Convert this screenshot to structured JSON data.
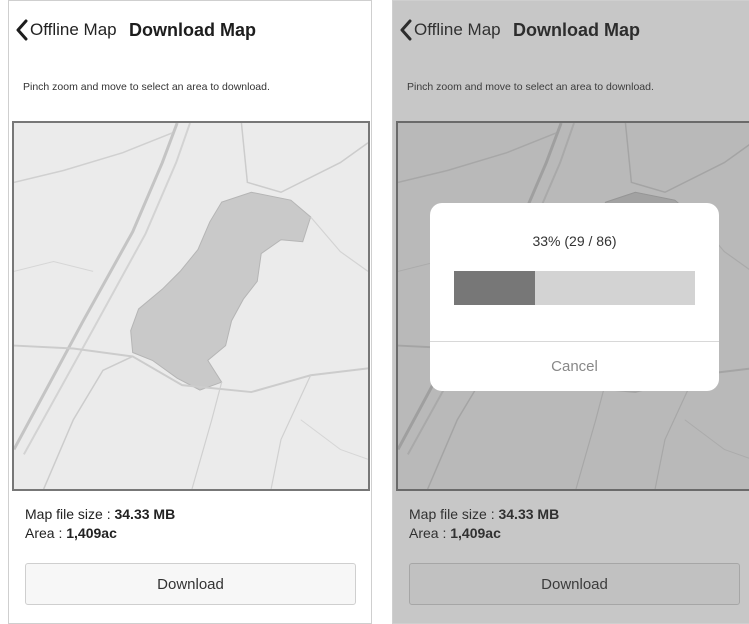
{
  "left": {
    "nav": {
      "back_label": "Offline Map",
      "title": "Download Map"
    },
    "instructions": "Pinch zoom and move to select an area to download.",
    "info": {
      "size_label": "Map file size : ",
      "size_value": "34.33 MB",
      "area_label": "Area : ",
      "area_value": "1,409ac"
    },
    "download_label": "Download"
  },
  "right": {
    "nav": {
      "back_label": "Offline Map",
      "title": "Download Map"
    },
    "instructions": "Pinch zoom and move to select an area to download.",
    "info": {
      "size_label": "Map file size : ",
      "size_value": "34.33 MB",
      "area_label": "Area : ",
      "area_value": "1,409ac"
    },
    "download_label": "Download",
    "dialog": {
      "progress_text": "33% (29 / 86)",
      "progress_fraction": 0.337,
      "cancel_label": "Cancel"
    }
  },
  "colors": {
    "progress_fill": "#777777",
    "progress_track": "#d3d3d3",
    "lake": "#c9c9c9",
    "map_bg": "#ebebeb"
  },
  "icons": {
    "back": "chevron-left-icon"
  }
}
